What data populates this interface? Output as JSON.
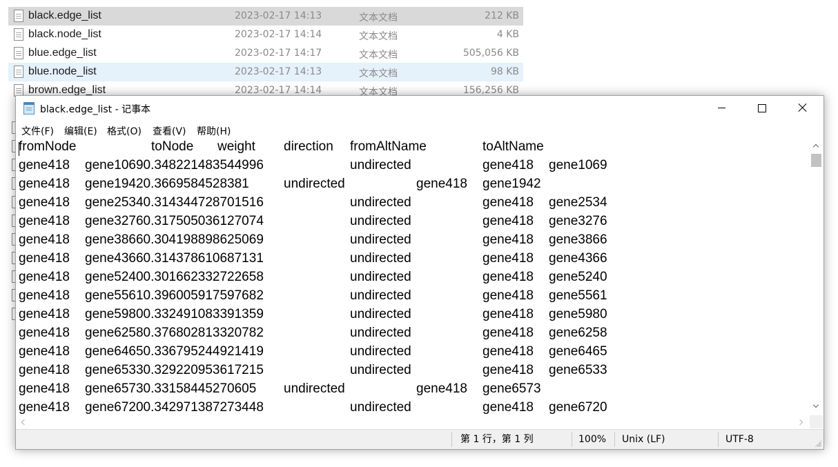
{
  "explorer": {
    "files": [
      {
        "name": "black.edge_list",
        "date": "2023-02-17 14:13",
        "type": "文本文档",
        "size": "212 KB"
      },
      {
        "name": "black.node_list",
        "date": "2023-02-17 14:14",
        "type": "文本文档",
        "size": "4 KB"
      },
      {
        "name": "blue.edge_list",
        "date": "2023-02-17 14:17",
        "type": "文本文档",
        "size": "505,056 KB"
      },
      {
        "name": "blue.node_list",
        "date": "2023-02-17 14:13",
        "type": "文本文档",
        "size": "98 KB"
      },
      {
        "name": "brown.edge_list",
        "date": "2023-02-17 14:14",
        "type": "文本文档",
        "size": "156,256 KB"
      }
    ]
  },
  "notepad": {
    "title": "black.edge_list - 记事本",
    "menu": {
      "file": "文件(F)",
      "edit": "编辑(E)",
      "format": "格式(O)",
      "view": "查看(V)",
      "help": "帮助(H)"
    },
    "lines": [
      [
        "fromNode",
        "toNode",
        "weight",
        "direction",
        "fromAltName",
        "toAltName"
      ],
      [
        "gene418",
        "gene10690.348221483544996",
        "undirected",
        "gene418",
        "gene1069"
      ],
      [
        "gene418",
        "gene19420.3669584528381",
        "undirected",
        "gene418",
        "gene1942"
      ],
      [
        "gene418",
        "gene25340.314344728701516",
        "undirected",
        "gene418",
        "gene2534"
      ],
      [
        "gene418",
        "gene32760.317505036127074",
        "undirected",
        "gene418",
        "gene3276"
      ],
      [
        "gene418",
        "gene38660.304198898625069",
        "undirected",
        "gene418",
        "gene3866"
      ],
      [
        "gene418",
        "gene43660.314378610687131",
        "undirected",
        "gene418",
        "gene4366"
      ],
      [
        "gene418",
        "gene52400.301662332722658",
        "undirected",
        "gene418",
        "gene5240"
      ],
      [
        "gene418",
        "gene55610.396005917597682",
        "undirected",
        "gene418",
        "gene5561"
      ],
      [
        "gene418",
        "gene59800.332491083391359",
        "undirected",
        "gene418",
        "gene5980"
      ],
      [
        "gene418",
        "gene62580.376802813320782",
        "undirected",
        "gene418",
        "gene6258"
      ],
      [
        "gene418",
        "gene64650.336795244921419",
        "undirected",
        "gene418",
        "gene6465"
      ],
      [
        "gene418",
        "gene65330.329220953617215",
        "undirected",
        "gene418",
        "gene6533"
      ],
      [
        "gene418",
        "gene65730.33158445270605",
        "undirected",
        "gene418",
        "gene6573"
      ],
      [
        "gene418",
        "gene67200.342971387273448",
        "undirected",
        "gene418",
        "gene6720"
      ]
    ],
    "status": {
      "position": "第 1 行，第 1 列",
      "zoom": "100%",
      "line_ending": "Unix (LF)",
      "encoding": "UTF-8"
    }
  }
}
